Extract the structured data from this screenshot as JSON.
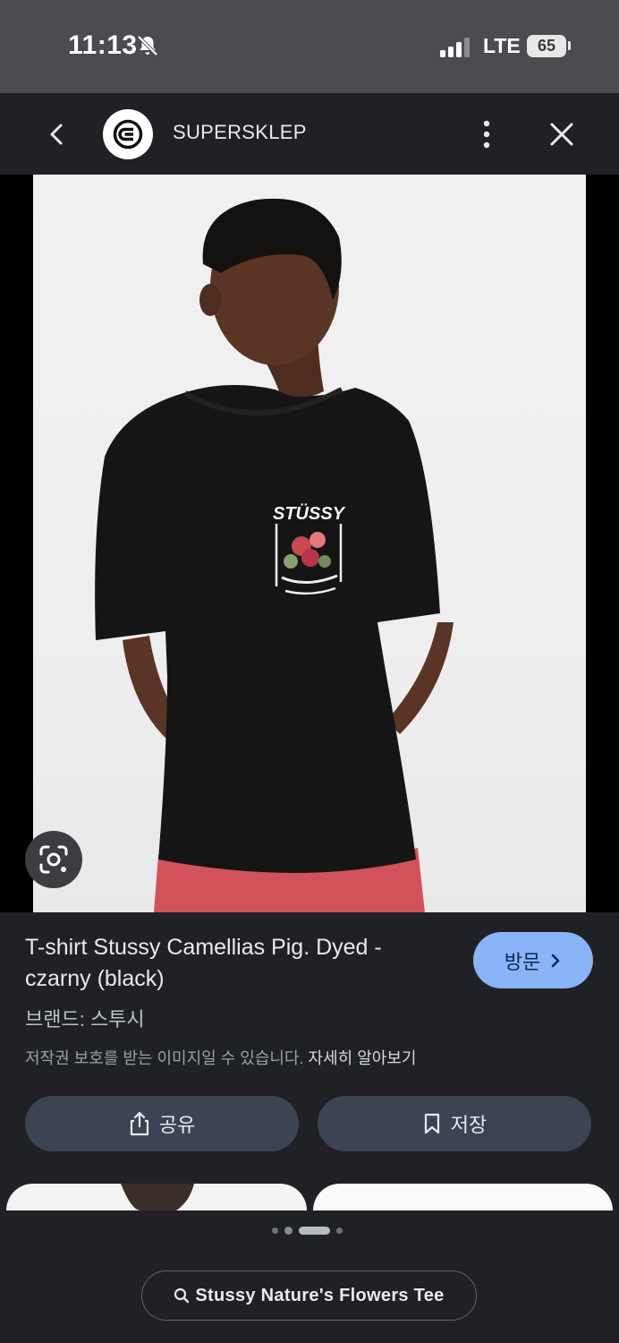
{
  "status_bar": {
    "time": "11:13",
    "network": "LTE",
    "battery": "65"
  },
  "header": {
    "site_name": "SUPERSKLEP",
    "logo_icon": "superisklep-logo",
    "back_icon": "chevron-left-icon",
    "more_icon": "more-vert-icon",
    "close_icon": "close-icon"
  },
  "product": {
    "title": "T-shirt Stussy Camellias Pig. Dyed - czarny (black)",
    "visit_label": "방문",
    "brand": "브랜드: 스투시",
    "copyright_notice": "저작권 보호를 받는 이미지일 수 있습니다.",
    "learn_more": "자세히 알아보기",
    "print_text": "STÜSSY"
  },
  "actions": {
    "share_label": "공유",
    "save_label": "저장"
  },
  "carousel": {
    "page_count": 4,
    "active_index": 2
  },
  "search": {
    "query": "Stussy Nature's Flowers Tee"
  },
  "colors": {
    "accent": "#8ab4f8",
    "background": "#202124",
    "button": "#3c4453"
  }
}
